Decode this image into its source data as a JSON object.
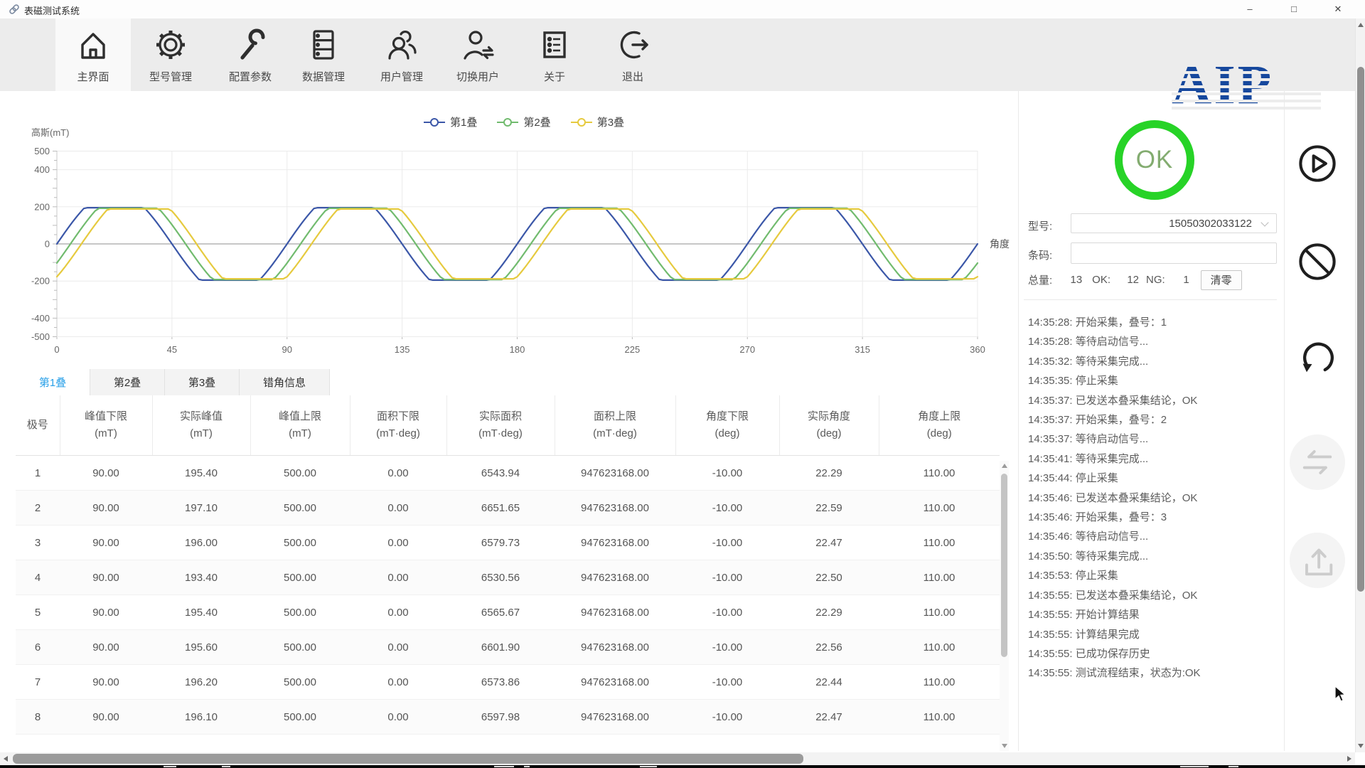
{
  "window": {
    "title": "表磁测试系统",
    "controls": {
      "minimize": "–",
      "maximize": "□",
      "close": "✕"
    }
  },
  "toolbar": {
    "items": [
      {
        "label": "主界面",
        "icon": "home-icon",
        "active": true
      },
      {
        "label": "型号管理",
        "icon": "gear-icon",
        "active": false
      },
      {
        "label": "配置参数",
        "icon": "wrench-icon",
        "active": false
      },
      {
        "label": "数据管理",
        "icon": "database-icon",
        "active": false
      },
      {
        "label": "用户管理",
        "icon": "users-icon",
        "active": false
      },
      {
        "label": "切换用户",
        "icon": "switch-user-icon",
        "active": false
      },
      {
        "label": "关于",
        "icon": "about-list-icon",
        "active": false
      },
      {
        "label": "退出",
        "icon": "exit-icon",
        "active": false
      }
    ]
  },
  "logo": {
    "text": "AIP",
    "color": "#16489d"
  },
  "chart": {
    "type": "line",
    "y_label": "高斯(mT)",
    "x_label": "角度",
    "xlim": [
      0,
      360
    ],
    "ylim": [
      -500,
      500
    ],
    "x_ticks": [
      0,
      45,
      90,
      135,
      180,
      225,
      270,
      315,
      360
    ],
    "y_tick_labels": [
      500,
      400,
      200,
      0,
      -200,
      -400,
      -500
    ],
    "grid": true,
    "legend_position": "top",
    "series": [
      {
        "name": "第1叠",
        "color": "#3b57a8",
        "phase_deg": 0,
        "period_deg": 90,
        "plateau": 195,
        "drive_amplitude": 285
      },
      {
        "name": "第2叠",
        "color": "#71bb6e",
        "phase_deg": 5.3,
        "period_deg": 90,
        "plateau": 192,
        "drive_amplitude": 285
      },
      {
        "name": "第3叠",
        "color": "#e6ca3e",
        "phase_deg": 9.6,
        "period_deg": 90,
        "plateau": 188,
        "drive_amplitude": 285
      }
    ]
  },
  "tabs": [
    {
      "label": "第1叠",
      "active": true
    },
    {
      "label": "第2叠",
      "active": false
    },
    {
      "label": "第3叠",
      "active": false
    },
    {
      "label": "错角信息",
      "active": false
    }
  ],
  "table": {
    "headers": [
      {
        "l1": "极号",
        "l2": ""
      },
      {
        "l1": "峰值下限",
        "l2": "(mT)"
      },
      {
        "l1": "实际峰值",
        "l2": "(mT)"
      },
      {
        "l1": "峰值上限",
        "l2": "(mT)"
      },
      {
        "l1": "面积下限",
        "l2": "(mT·deg)"
      },
      {
        "l1": "实际面积",
        "l2": "(mT·deg)"
      },
      {
        "l1": "面积上限",
        "l2": "(mT·deg)"
      },
      {
        "l1": "角度下限",
        "l2": "(deg)"
      },
      {
        "l1": "实际角度",
        "l2": "(deg)"
      },
      {
        "l1": "角度上限",
        "l2": "(deg)"
      }
    ],
    "rows": [
      [
        "1",
        "90.00",
        "195.40",
        "500.00",
        "0.00",
        "6543.94",
        "947623168.00",
        "-10.00",
        "22.29",
        "110.00"
      ],
      [
        "2",
        "90.00",
        "197.10",
        "500.00",
        "0.00",
        "6651.65",
        "947623168.00",
        "-10.00",
        "22.59",
        "110.00"
      ],
      [
        "3",
        "90.00",
        "196.00",
        "500.00",
        "0.00",
        "6579.73",
        "947623168.00",
        "-10.00",
        "22.47",
        "110.00"
      ],
      [
        "4",
        "90.00",
        "193.40",
        "500.00",
        "0.00",
        "6530.56",
        "947623168.00",
        "-10.00",
        "22.50",
        "110.00"
      ],
      [
        "5",
        "90.00",
        "195.40",
        "500.00",
        "0.00",
        "6565.67",
        "947623168.00",
        "-10.00",
        "22.29",
        "110.00"
      ],
      [
        "6",
        "90.00",
        "195.60",
        "500.00",
        "0.00",
        "6601.90",
        "947623168.00",
        "-10.00",
        "22.56",
        "110.00"
      ],
      [
        "7",
        "90.00",
        "196.20",
        "500.00",
        "0.00",
        "6573.86",
        "947623168.00",
        "-10.00",
        "22.44",
        "110.00"
      ],
      [
        "8",
        "90.00",
        "196.10",
        "500.00",
        "0.00",
        "6597.98",
        "947623168.00",
        "-10.00",
        "22.47",
        "110.00"
      ]
    ]
  },
  "panel": {
    "status": "OK",
    "status_color": "#27d327",
    "model_label": "型号:",
    "model_value": "15050302033122",
    "barcode_label": "条码:",
    "barcode_value": "",
    "total_label": "总量:",
    "total_value": "13",
    "ok_label": "OK:",
    "ok_value": "12",
    "ng_label": "NG:",
    "ng_value": "1",
    "clear_button": "清零"
  },
  "log": [
    "14:35:28: 开始采集，叠号：1",
    "14:35:28: 等待启动信号...",
    "14:35:32: 等待采集完成...",
    "14:35:35: 停止采集",
    "14:35:37: 已发送本叠采集结论，OK",
    "14:35:37: 开始采集，叠号：2",
    "14:35:37: 等待启动信号...",
    "14:35:41: 等待采集完成...",
    "14:35:44: 停止采集",
    "14:35:46: 已发送本叠采集结论，OK",
    "14:35:46: 开始采集，叠号：3",
    "14:35:46: 等待启动信号...",
    "14:35:50: 等待采集完成...",
    "14:35:53: 停止采集",
    "14:35:55: 已发送本叠采集结论，OK",
    "14:35:55: 开始计算结果",
    "14:35:55: 计算结果完成",
    "14:35:55: 已成功保存历史",
    "14:35:55: 测试流程结束，状态为:OK"
  ],
  "actions": [
    {
      "icon": "play-icon",
      "enabled": true
    },
    {
      "icon": "stop-icon",
      "enabled": true
    },
    {
      "icon": "restart-icon",
      "enabled": true
    },
    {
      "icon": "sync-icon",
      "enabled": false
    },
    {
      "icon": "upload-icon",
      "enabled": false
    }
  ]
}
